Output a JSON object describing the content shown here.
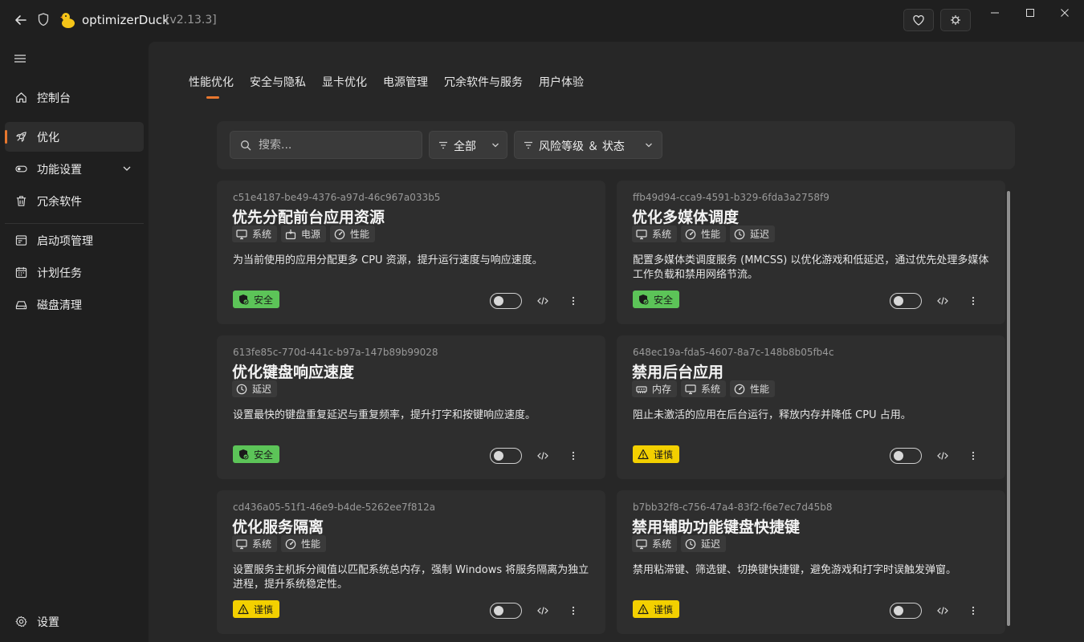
{
  "titlebar": {
    "app_name": "optimizerDuck",
    "version": "[v2.13.3]",
    "icons": [
      "back-arrow-icon",
      "shield-icon",
      "duck-logo-icon",
      "heart-icon",
      "settings-bug-icon",
      "minimize-icon",
      "maximize-icon",
      "close-icon"
    ]
  },
  "sidebar": {
    "items": [
      {
        "label": "控制台",
        "icon": "home-icon"
      },
      {
        "label": "优化",
        "icon": "rocket-icon",
        "active": true
      },
      {
        "label": "功能设置",
        "icon": "toggle-icon",
        "expandable": true
      },
      {
        "label": "冗余软件",
        "icon": "trash-icon"
      },
      {
        "label": "启动项管理",
        "icon": "startup-icon"
      },
      {
        "label": "计划任务",
        "icon": "calendar-icon"
      },
      {
        "label": "磁盘清理",
        "icon": "disk-icon"
      }
    ],
    "settings_label": "设置"
  },
  "tabs": [
    "性能优化",
    "安全与隐私",
    "显卡优化",
    "电源管理",
    "冗余软件与服务",
    "用户体验"
  ],
  "filter": {
    "search_placeholder": "搜索...",
    "category": "全部",
    "risk": "风险等级 ＆ 状态"
  },
  "colors": {
    "accent": "#e8772e",
    "safe": "#5cc458",
    "caution": "#f3d000"
  },
  "cards": [
    {
      "id": "c51e4187-be49-4376-a97d-46c967a033b5",
      "title": "优先分配前台应用资源",
      "tags": [
        {
          "label": "系统",
          "icon": "monitor-icon"
        },
        {
          "label": "电源",
          "icon": "power-icon"
        },
        {
          "label": "性能",
          "icon": "gauge-icon"
        }
      ],
      "desc": "为当前使用的应用分配更多 CPU 资源，提升运行速度与响应速度。",
      "risk": "安全",
      "level": "safe",
      "enabled": false
    },
    {
      "id": "ffb49d94-cca9-4591-b329-6fda3a2758f9",
      "title": "优化多媒体调度",
      "tags": [
        {
          "label": "系统",
          "icon": "monitor-icon"
        },
        {
          "label": "性能",
          "icon": "gauge-icon"
        },
        {
          "label": "延迟",
          "icon": "clock-icon"
        }
      ],
      "desc": "配置多媒体类调度服务 (MMCSS) 以优化游戏和低延迟，通过优先处理多媒体工作负载和禁用网络节流。",
      "risk": "安全",
      "level": "safe",
      "enabled": false
    },
    {
      "id": "613fe85c-770d-441c-b97a-147b89b99028",
      "title": "优化键盘响应速度",
      "tags": [
        {
          "label": "延迟",
          "icon": "clock-icon"
        }
      ],
      "desc": "设置最快的键盘重复延迟与重复频率，提升打字和按键响应速度。",
      "risk": "安全",
      "level": "safe",
      "enabled": false
    },
    {
      "id": "648ec19a-fda5-4607-8a7c-148b8b05fb4c",
      "title": "禁用后台应用",
      "tags": [
        {
          "label": "内存",
          "icon": "memory-icon"
        },
        {
          "label": "系统",
          "icon": "monitor-icon"
        },
        {
          "label": "性能",
          "icon": "gauge-icon"
        }
      ],
      "desc": "阻止未激活的应用在后台运行，释放内存并降低 CPU 占用。",
      "risk": "谨慎",
      "level": "warn",
      "enabled": false
    },
    {
      "id": "cd436a05-51f1-46e9-b4de-5262ee7f812a",
      "title": "优化服务隔离",
      "tags": [
        {
          "label": "系统",
          "icon": "monitor-icon"
        },
        {
          "label": "性能",
          "icon": "gauge-icon"
        }
      ],
      "desc": "设置服务主机拆分阈值以匹配系统总内存，强制 Windows 将服务隔离为独立进程，提升系统稳定性。",
      "risk": "谨慎",
      "level": "warn",
      "enabled": false
    },
    {
      "id": "b7bb32f8-c756-47a4-83f2-f6e7ec7d45b8",
      "title": "禁用辅助功能键盘快捷键",
      "tags": [
        {
          "label": "系统",
          "icon": "monitor-icon"
        },
        {
          "label": "延迟",
          "icon": "clock-icon"
        }
      ],
      "desc": "禁用粘滞键、筛选键、切换键快捷键，避免游戏和打字时误触发弹窗。",
      "risk": "谨慎",
      "level": "warn",
      "enabled": false
    }
  ]
}
